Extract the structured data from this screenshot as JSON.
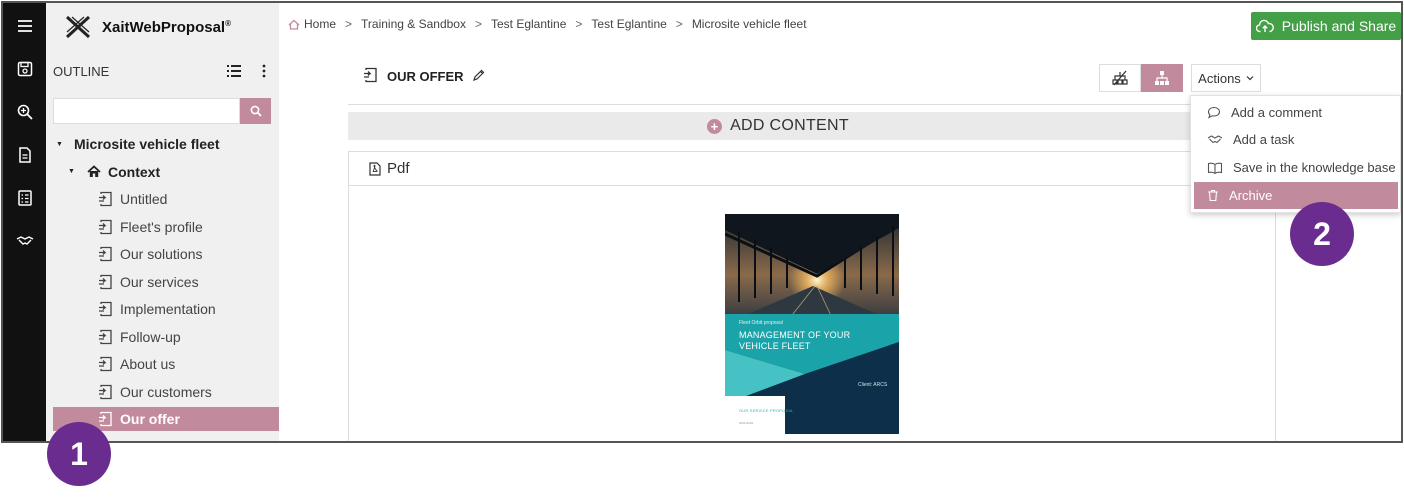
{
  "app": {
    "name": "XaitWebProposal",
    "trademark": "®"
  },
  "sidebar": {
    "outline_label": "OUTLINE",
    "search_placeholder": "",
    "tree": [
      {
        "label": "Microsite vehicle fleet",
        "level": 0,
        "bold": true,
        "caret": true,
        "icon": "none"
      },
      {
        "label": "Context",
        "level": 1,
        "bold": true,
        "caret": true,
        "icon": "home-icon"
      },
      {
        "label": "Untitled",
        "level": 2,
        "icon": "page-icon"
      },
      {
        "label": "Fleet's profile",
        "level": 2,
        "icon": "page-icon"
      },
      {
        "label": "Our solutions",
        "level": 2,
        "icon": "page-icon"
      },
      {
        "label": "Our services",
        "level": 2,
        "icon": "page-icon"
      },
      {
        "label": "Implementation",
        "level": 2,
        "icon": "page-icon"
      },
      {
        "label": "Follow-up",
        "level": 2,
        "icon": "page-icon"
      },
      {
        "label": "About us",
        "level": 2,
        "icon": "page-icon"
      },
      {
        "label": "Our customers",
        "level": 2,
        "icon": "page-icon"
      },
      {
        "label": "Our offer",
        "level": 2,
        "icon": "page-icon",
        "active": true
      }
    ]
  },
  "breadcrumb": [
    "Home",
    "Training & Sandbox",
    "Test Eglantine",
    "Test Eglantine",
    "Microsite vehicle fleet"
  ],
  "header": {
    "publish_label": "Publish and Share"
  },
  "page": {
    "title": "OUR OFFER",
    "actions_label": "Actions",
    "add_content_label": "ADD CONTENT",
    "panel_label": "Pdf"
  },
  "cover": {
    "kicker": "Fleet Orbit proposal",
    "title": "MANAGEMENT OF YOUR VEHICLE FLEET",
    "client": "Client: ARCS",
    "footer": "OUR SERVICE PROPOSAL",
    "date": "2021/2022"
  },
  "actions_menu": [
    {
      "label": "Add a comment",
      "icon": "comment-icon"
    },
    {
      "label": "Add a task",
      "icon": "handshake-icon"
    },
    {
      "label": "Save in the knowledge base",
      "icon": "book-icon"
    },
    {
      "label": "Archive",
      "icon": "trash-icon",
      "highlighted": true
    }
  ],
  "steps": [
    "1",
    "2"
  ],
  "colors": {
    "accent": "#c28a9d",
    "publish": "#43a047",
    "badge": "#6a2d8f",
    "rail": "#111111"
  }
}
